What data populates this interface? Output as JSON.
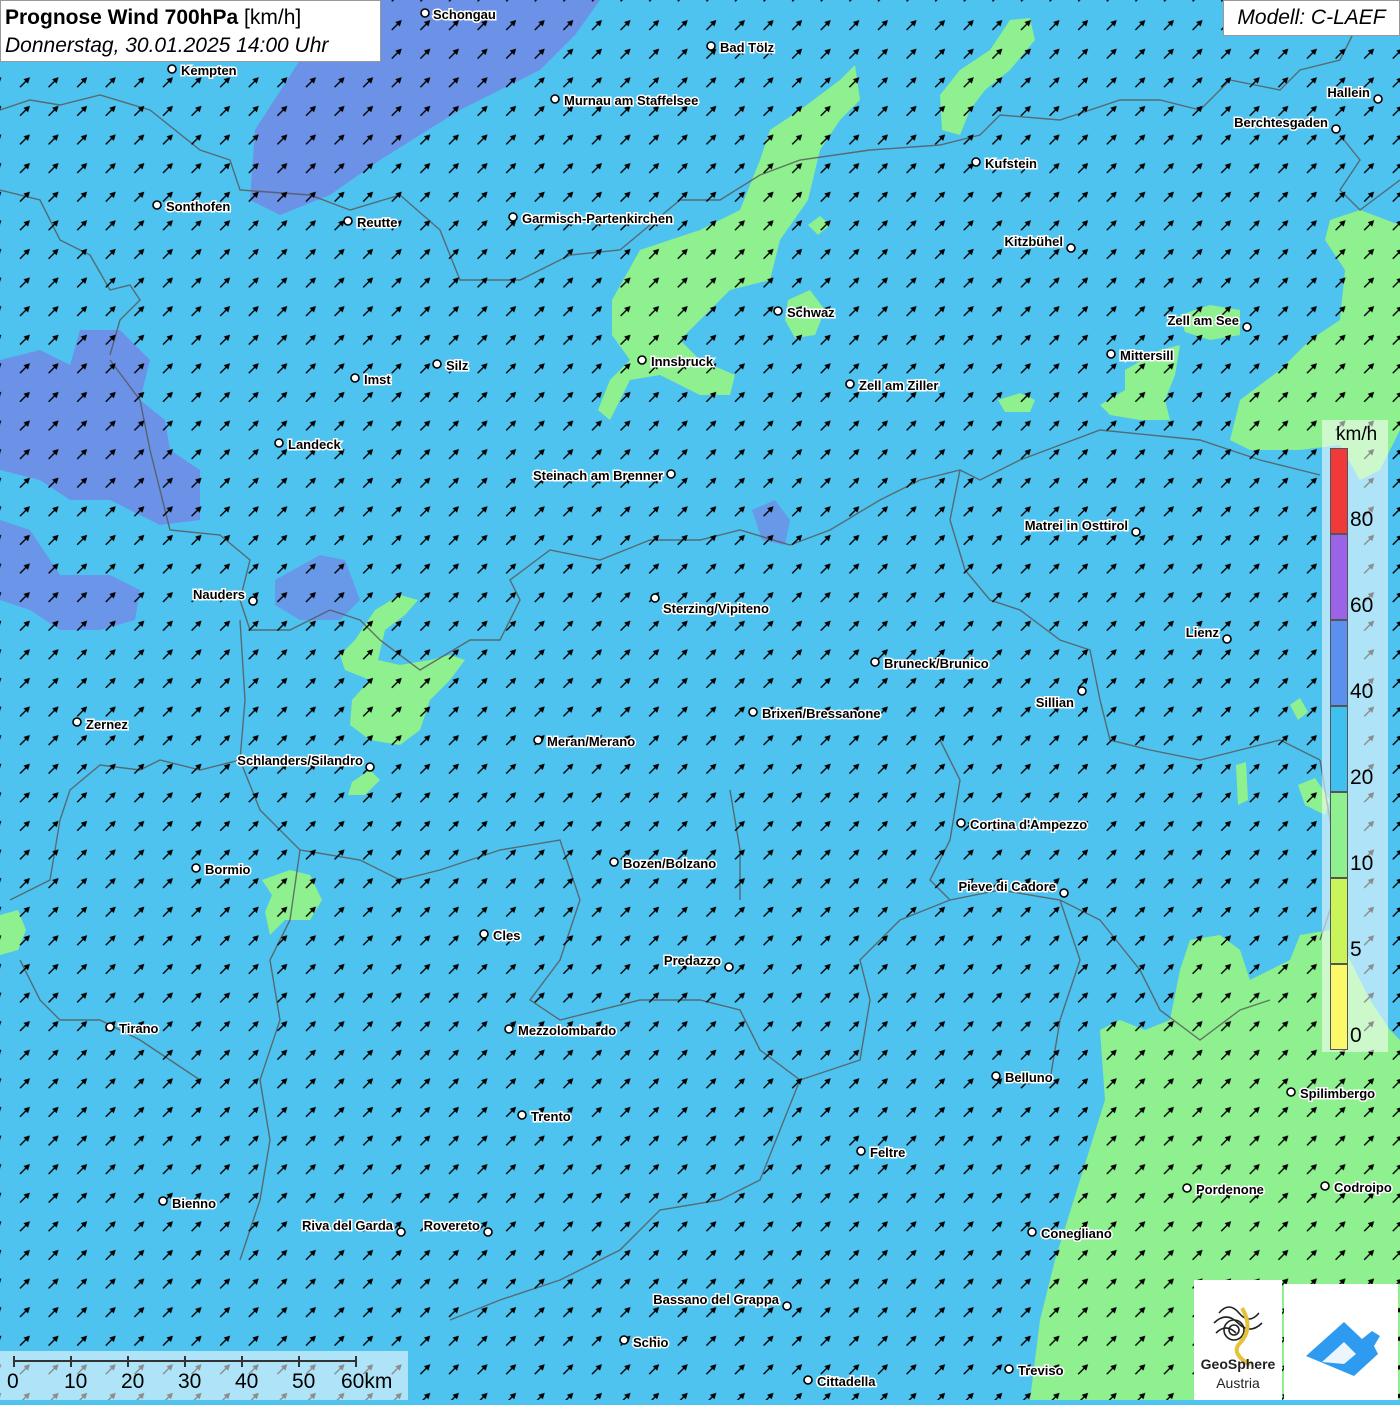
{
  "header": {
    "title_bold": "Prognose Wind 700hPa",
    "title_unit": "[km/h]",
    "subtitle": "Donnerstag, 30.01.2025 14:00 Uhr",
    "model": "Modell: C-LAEF"
  },
  "legend": {
    "unit": "km/h",
    "levels": [
      {
        "label": "80",
        "color": "#f03a3a"
      },
      {
        "label": "60",
        "color": "#9a63e8"
      },
      {
        "label": "40",
        "color": "#5c90ef"
      },
      {
        "label": "20",
        "color": "#3fc0ef"
      },
      {
        "label": "10",
        "color": "#8ef08e"
      },
      {
        "label": "5",
        "color": "#c9f55a"
      },
      {
        "label": "0",
        "color": "#fbf86a"
      }
    ]
  },
  "scale": {
    "labels": [
      "0",
      "10",
      "20",
      "30",
      "40",
      "50",
      "60km"
    ]
  },
  "logos": {
    "geosphere_line1": "GeoSphere",
    "geosphere_line2": "Austria"
  },
  "colors": {
    "base_wind": "#4fc3ef",
    "light_wind": "#8ef08e",
    "strong_wind": "#6e8de6",
    "accent_blue": "#2e9bf0"
  },
  "cities": [
    {
      "name": "Schongau",
      "dot": [
        425,
        13
      ],
      "lab": [
        433,
        14
      ],
      "anchor": "start"
    },
    {
      "name": "Bad Tölz",
      "dot": [
        711,
        46
      ],
      "lab": [
        720,
        47
      ],
      "anchor": "start"
    },
    {
      "name": "Kempten",
      "dot": [
        172,
        69
      ],
      "lab": [
        181,
        70
      ],
      "anchor": "start"
    },
    {
      "name": "Murnau am Staffelsee",
      "dot": [
        555,
        99
      ],
      "lab": [
        564,
        100
      ],
      "anchor": "start"
    },
    {
      "name": "Hallein",
      "dot": [
        1378,
        99
      ],
      "lab": [
        1370,
        92
      ],
      "anchor": "end"
    },
    {
      "name": "Berchtesgaden",
      "dot": [
        1336,
        129
      ],
      "lab": [
        1328,
        122
      ],
      "anchor": "end"
    },
    {
      "name": "Kufstein",
      "dot": [
        976,
        162
      ],
      "lab": [
        985,
        163
      ],
      "anchor": "start"
    },
    {
      "name": "Sonthofen",
      "dot": [
        157,
        205
      ],
      "lab": [
        166,
        206
      ],
      "anchor": "start"
    },
    {
      "name": "Garmisch-Partenkirchen",
      "dot": [
        513,
        217
      ],
      "lab": [
        522,
        218
      ],
      "anchor": "start"
    },
    {
      "name": "Reutte",
      "dot": [
        348,
        221
      ],
      "lab": [
        357,
        222
      ],
      "anchor": "start"
    },
    {
      "name": "Kitzbühel",
      "dot": [
        1071,
        248
      ],
      "lab": [
        1063,
        241
      ],
      "anchor": "end"
    },
    {
      "name": "Schwaz",
      "dot": [
        778,
        311
      ],
      "lab": [
        787,
        312
      ],
      "anchor": "start"
    },
    {
      "name": "Zell am See",
      "dot": [
        1247,
        327
      ],
      "lab": [
        1239,
        320
      ],
      "anchor": "end"
    },
    {
      "name": "Mittersill",
      "dot": [
        1111,
        354
      ],
      "lab": [
        1120,
        355
      ],
      "anchor": "start"
    },
    {
      "name": "Innsbruck",
      "dot": [
        642,
        360
      ],
      "lab": [
        651,
        361
      ],
      "anchor": "start"
    },
    {
      "name": "Silz",
      "dot": [
        437,
        364
      ],
      "lab": [
        446,
        365
      ],
      "anchor": "start"
    },
    {
      "name": "Imst",
      "dot": [
        355,
        378
      ],
      "lab": [
        364,
        379
      ],
      "anchor": "start"
    },
    {
      "name": "Zell am Ziller",
      "dot": [
        850,
        384
      ],
      "lab": [
        859,
        385
      ],
      "anchor": "start"
    },
    {
      "name": "Landeck",
      "dot": [
        279,
        443
      ],
      "lab": [
        288,
        444
      ],
      "anchor": "start"
    },
    {
      "name": "Steinach am Brenner",
      "dot": [
        671,
        474
      ],
      "lab": [
        663,
        475
      ],
      "anchor": "end"
    },
    {
      "name": "Matrei in Osttirol",
      "dot": [
        1136,
        532
      ],
      "lab": [
        1128,
        525
      ],
      "anchor": "end"
    },
    {
      "name": "Nauders",
      "dot": [
        253,
        601
      ],
      "lab": [
        245,
        594
      ],
      "anchor": "end"
    },
    {
      "name": "Sterzing/Vipiteno",
      "dot": [
        655,
        598
      ],
      "lab": [
        663,
        608
      ],
      "anchor": "start"
    },
    {
      "name": "Lienz",
      "dot": [
        1227,
        639
      ],
      "lab": [
        1219,
        632
      ],
      "anchor": "end"
    },
    {
      "name": "Bruneck/Brunico",
      "dot": [
        875,
        662
      ],
      "lab": [
        884,
        663
      ],
      "anchor": "start"
    },
    {
      "name": "Sillian",
      "dot": [
        1082,
        691
      ],
      "lab": [
        1074,
        702
      ],
      "anchor": "end"
    },
    {
      "name": "Brixen/Bressanone",
      "dot": [
        753,
        712
      ],
      "lab": [
        762,
        713
      ],
      "anchor": "start"
    },
    {
      "name": "Zernez",
      "dot": [
        77,
        722
      ],
      "lab": [
        86,
        724
      ],
      "anchor": "start"
    },
    {
      "name": "Meran/Merano",
      "dot": [
        538,
        740
      ],
      "lab": [
        547,
        741
      ],
      "anchor": "start"
    },
    {
      "name": "Schlanders/Silandro",
      "dot": [
        370,
        767
      ],
      "lab": [
        363,
        760
      ],
      "anchor": "end"
    },
    {
      "name": "Cortina d'Ampezzo",
      "dot": [
        961,
        823
      ],
      "lab": [
        970,
        824
      ],
      "anchor": "start"
    },
    {
      "name": "Bozen/Bolzano",
      "dot": [
        614,
        862
      ],
      "lab": [
        623,
        863
      ],
      "anchor": "start"
    },
    {
      "name": "Bormio",
      "dot": [
        196,
        868
      ],
      "lab": [
        205,
        869
      ],
      "anchor": "start"
    },
    {
      "name": "Pieve di Cadore",
      "dot": [
        1064,
        893
      ],
      "lab": [
        1056,
        886
      ],
      "anchor": "end"
    },
    {
      "name": "Cles",
      "dot": [
        484,
        934
      ],
      "lab": [
        493,
        935
      ],
      "anchor": "start"
    },
    {
      "name": "Predazzo",
      "dot": [
        729,
        967
      ],
      "lab": [
        721,
        960
      ],
      "anchor": "end"
    },
    {
      "name": "Tirano",
      "dot": [
        110,
        1027
      ],
      "lab": [
        119,
        1028
      ],
      "anchor": "start"
    },
    {
      "name": "Mezzolombardo",
      "dot": [
        509,
        1029
      ],
      "lab": [
        518,
        1030
      ],
      "anchor": "start"
    },
    {
      "name": "Belluno",
      "dot": [
        996,
        1076
      ],
      "lab": [
        1005,
        1077
      ],
      "anchor": "start"
    },
    {
      "name": "Spilimbergo",
      "dot": [
        1291,
        1092
      ],
      "lab": [
        1300,
        1093
      ],
      "anchor": "start"
    },
    {
      "name": "Trento",
      "dot": [
        522,
        1115
      ],
      "lab": [
        531,
        1116
      ],
      "anchor": "start"
    },
    {
      "name": "Feltre",
      "dot": [
        861,
        1151
      ],
      "lab": [
        870,
        1152
      ],
      "anchor": "start"
    },
    {
      "name": "Pordenone",
      "dot": [
        1187,
        1188
      ],
      "lab": [
        1196,
        1189
      ],
      "anchor": "start"
    },
    {
      "name": "Codroipo",
      "dot": [
        1325,
        1186
      ],
      "lab": [
        1334,
        1187
      ],
      "anchor": "start"
    },
    {
      "name": "Bienno",
      "dot": [
        163,
        1201
      ],
      "lab": [
        172,
        1203
      ],
      "anchor": "start"
    },
    {
      "name": "Riva del Garda",
      "dot": [
        401,
        1232
      ],
      "lab": [
        393,
        1225
      ],
      "anchor": "end"
    },
    {
      "name": "Rovereto",
      "dot": [
        488,
        1232
      ],
      "lab": [
        480,
        1225
      ],
      "anchor": "end"
    },
    {
      "name": "Conegliano",
      "dot": [
        1032,
        1232
      ],
      "lab": [
        1041,
        1233
      ],
      "anchor": "start"
    },
    {
      "name": "Bassano del Grappa",
      "dot": [
        787,
        1306
      ],
      "lab": [
        779,
        1299
      ],
      "anchor": "end"
    },
    {
      "name": "Schio",
      "dot": [
        624,
        1340
      ],
      "lab": [
        633,
        1342
      ],
      "anchor": "start"
    },
    {
      "name": "Treviso",
      "dot": [
        1009,
        1369
      ],
      "lab": [
        1018,
        1370
      ],
      "anchor": "start"
    },
    {
      "name": "Cittadella",
      "dot": [
        808,
        1380
      ],
      "lab": [
        817,
        1381
      ],
      "anchor": "start"
    }
  ]
}
